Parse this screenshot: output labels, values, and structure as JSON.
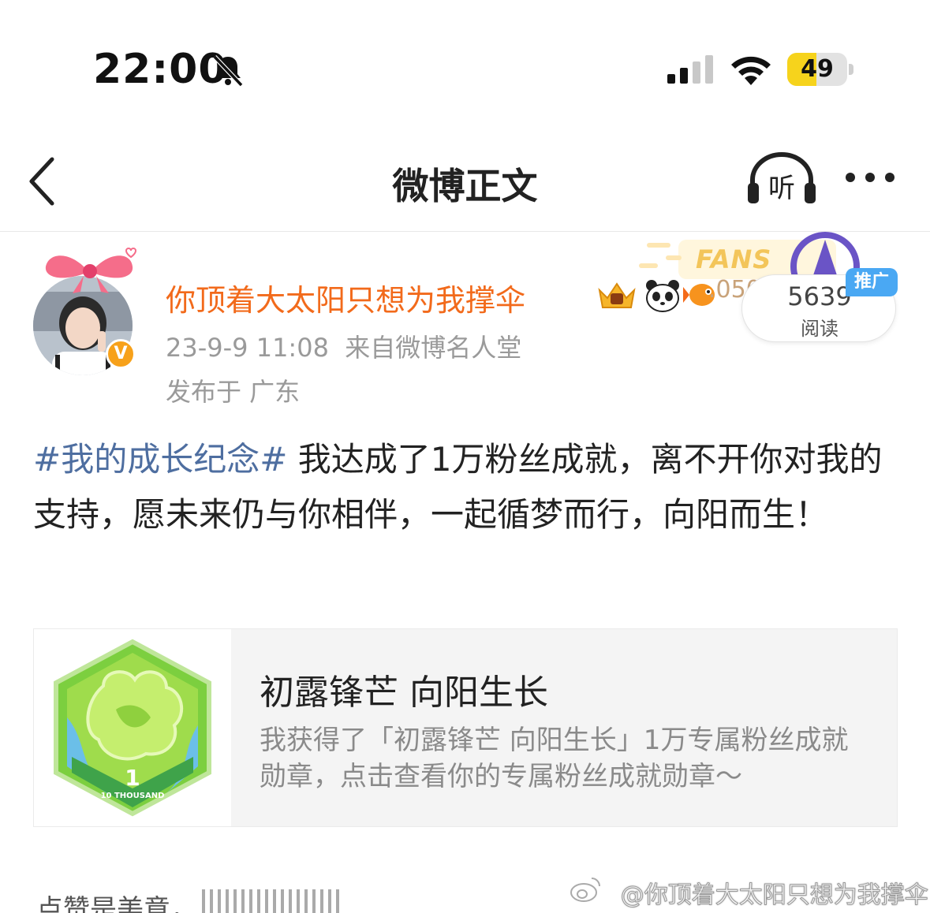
{
  "status_bar": {
    "time": "22:00",
    "battery_level": "49",
    "battery_fraction": 0.49,
    "icons": [
      "bell-slash-icon",
      "cellular-signal-icon",
      "wifi-icon",
      "battery-icon"
    ]
  },
  "nav": {
    "title": "微博正文",
    "back_icon": "chevron-left-icon",
    "listen_label": "听",
    "more_icon": "more-dots-icon"
  },
  "author": {
    "name": "你顶着大太阳只想为我撑伞",
    "verified_badge": "V",
    "fans_banner": "FANS",
    "fans_count_partial": ".0506",
    "timestamp": "23-9-9 11:08",
    "source": "来自微博名人堂",
    "location": "发布于 广东"
  },
  "read_stats": {
    "count": "5639",
    "label": "阅读",
    "promo_label": "推广"
  },
  "post": {
    "hashtag": "#我的成长纪念#",
    "text": " 我达成了1万粉丝成就，离不开你对我的支持，愿未来仍与你相伴，一起循梦而行，向阳而生！"
  },
  "card": {
    "title": "初露锋芒 向阳生长",
    "description": "我获得了「初露锋芒 向阳生长」1万专属粉丝成就勋章，点击查看你的专属粉丝成就勋章～",
    "medal_number": "1",
    "medal_caption": "10 THOUSAND"
  },
  "footer": {
    "like_hint": "点赞是美意，",
    "watermark": "@你顶着大太阳只想为我撑伞"
  },
  "colors": {
    "author_name": "#f26a1b",
    "hashtag": "#4e6ea0",
    "verified": "#f7a11a",
    "promo": "#4aa8f3",
    "battery": "#f6d31c"
  }
}
